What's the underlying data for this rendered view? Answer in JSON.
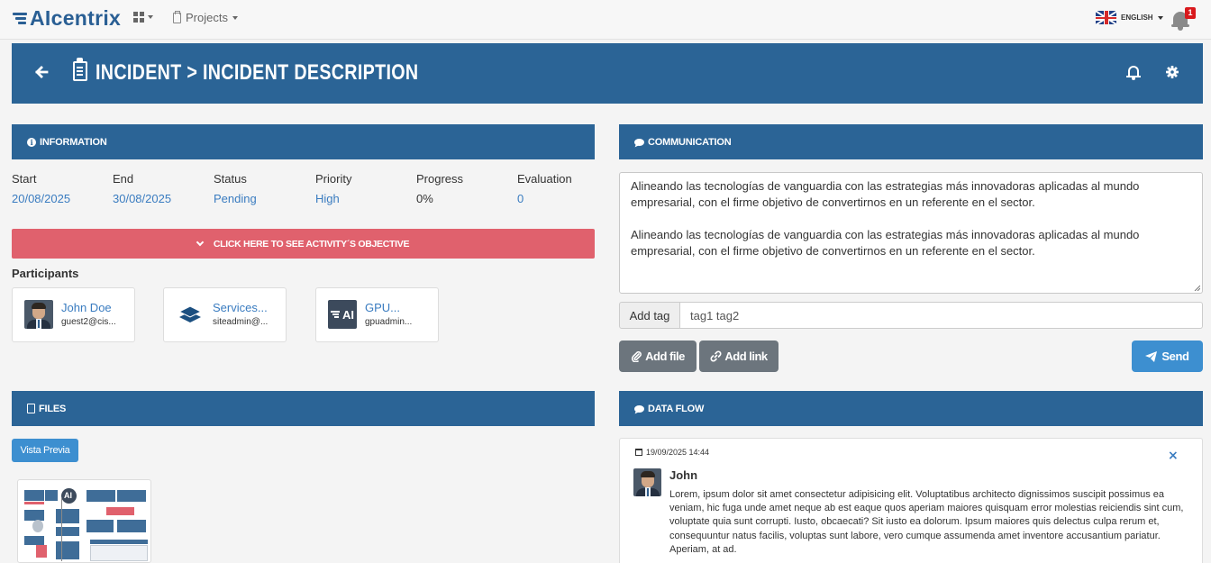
{
  "topnav": {
    "logo_text": "AIcentrix",
    "projects_label": "Projects",
    "language": "ENGLISH",
    "notifications_count": "1"
  },
  "banner": {
    "title": "INCIDENT > INCIDENT DESCRIPTION"
  },
  "information": {
    "header": "INFORMATION",
    "fields": [
      {
        "label": "Start",
        "value": "20/08/2025"
      },
      {
        "label": "End",
        "value": "30/08/2025"
      },
      {
        "label": "Status",
        "value": "Pending"
      },
      {
        "label": "Priority",
        "value": "High"
      },
      {
        "label": "Progress",
        "value": "0%"
      },
      {
        "label": "Evaluation",
        "value": "0"
      }
    ],
    "objective_button": "CLICK HERE TO SEE ACTIVITY´S OBJECTIVE",
    "participants_label": "Participants",
    "participants": [
      {
        "name": "John Doe",
        "email": "guest2@cis...",
        "avatar": "person-photo"
      },
      {
        "name": "Services...",
        "email": "siteadmin@...",
        "avatar": "layers-icon"
      },
      {
        "name": "GPU...",
        "email": "gpuadmin...",
        "avatar": "ai-logo"
      }
    ]
  },
  "communication": {
    "header": "COMMUNICATION",
    "message_paragraphs": [
      "Alineando las tecnologías de vanguardia con las estrategias más innovadoras aplicadas al mundo empresarial, con el firme objetivo de convertirnos en un referente en el sector.",
      "Alineando las tecnologías de vanguardia con las estrategias más innovadoras aplicadas al mundo empresarial, con el firme objetivo de convertirnos en un referente en el sector."
    ],
    "add_tag_label": "Add tag",
    "tag_placeholder": "tag1 tag2",
    "add_file_label": "Add file",
    "add_link_label": "Add link",
    "send_label": "Send"
  },
  "files": {
    "header": "FILES",
    "preview_button": "Vista Previa",
    "thumb_logo": "AI"
  },
  "data_flow": {
    "header": "DATA FLOW",
    "entry": {
      "date": "19/09/2025 14:44",
      "author": "John",
      "text": "Lorem, ipsum dolor sit amet consectetur adipisicing elit. Voluptatibus architecto dignissimos suscipit possimus ea veniam, hic fuga unde amet neque ab est eaque quos aperiam maiores quisquam error molestias reiciendis sint cum, voluptate quia sunt corrupti. Iusto, obcaecati? Sit iusto ea dolorum. Ipsum maiores quis delectus culpa rerum et, consequuntur natus facilis, voluptas sunt labore, vero cumque assumenda amet inventore accusantium pariatur. Aperiam, at ad."
    }
  },
  "colors": {
    "primary": "#2b6496",
    "accent_blue": "#3d8fd0",
    "link_blue": "#3a7cc0",
    "objective_red": "#e0616d",
    "secondary_gray": "#6c757d",
    "badge_red": "#d9191d"
  }
}
